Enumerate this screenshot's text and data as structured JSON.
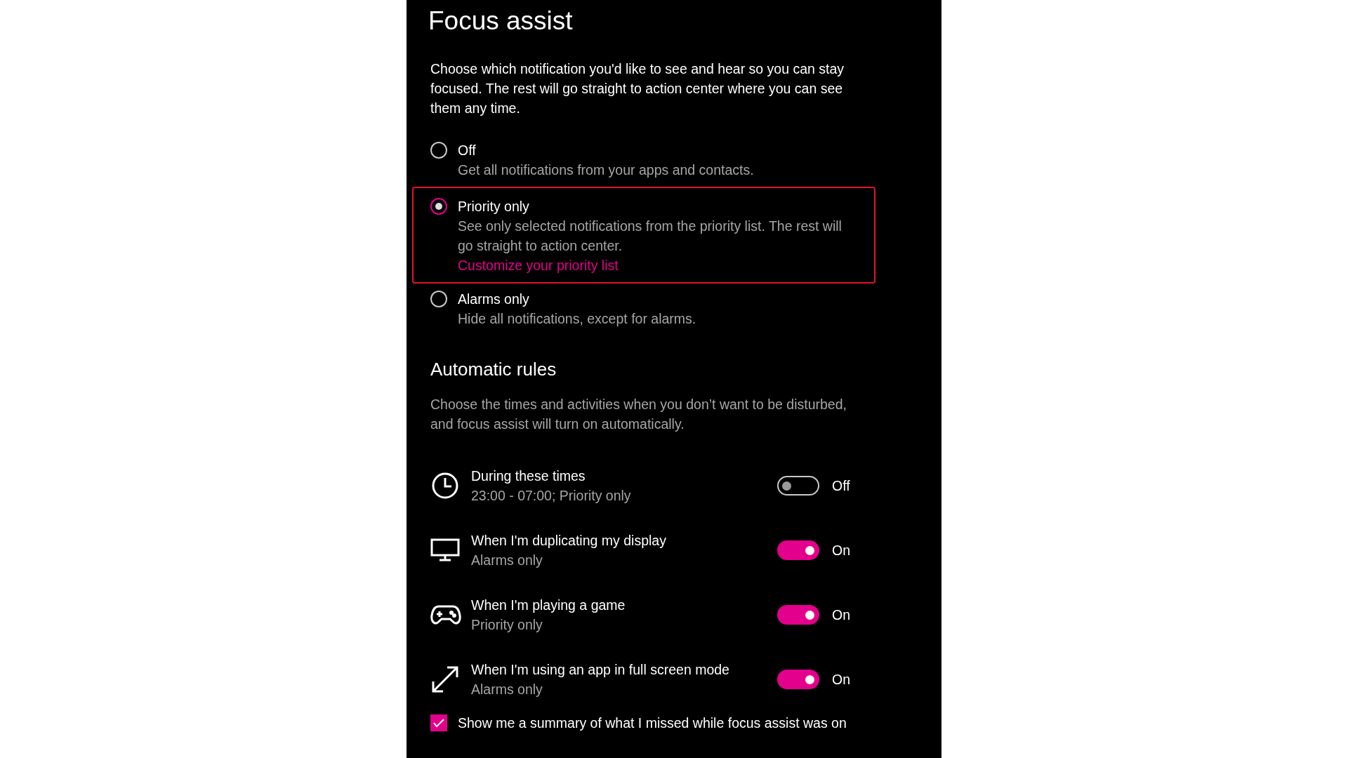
{
  "title": "Focus assist",
  "description": "Choose which notification you'd like to see and hear so you can stay focused. The rest will go straight to action center where you can see them any time.",
  "options": [
    {
      "label": "Off",
      "description": "Get all notifications from your apps and contacts.",
      "selected": false,
      "highlighted": false
    },
    {
      "label": "Priority only",
      "description": "See only selected notifications from the priority list. The rest will go straight to action center.",
      "link": "Customize your priority list",
      "selected": true,
      "highlighted": true
    },
    {
      "label": "Alarms only",
      "description": "Hide all notifications, except for alarms.",
      "selected": false,
      "highlighted": false
    }
  ],
  "automatic_rules": {
    "heading": "Automatic rules",
    "description": "Choose the times and activities when you don’t want to be disturbed, and focus assist will turn on automatically.",
    "rules": [
      {
        "kind": "schedule",
        "title": "During these times",
        "subtitle": "23:00 - 07:00; Priority only",
        "on": false,
        "state_label": "Off"
      },
      {
        "kind": "display",
        "title": "When I'm duplicating my display",
        "subtitle": "Alarms only",
        "on": true,
        "state_label": "On"
      },
      {
        "kind": "game",
        "title": "When I'm playing a game",
        "subtitle": "Priority only",
        "on": true,
        "state_label": "On"
      },
      {
        "kind": "fullscreen",
        "title": "When I'm using an app in full screen mode",
        "subtitle": "Alarms only",
        "on": true,
        "state_label": "On"
      }
    ]
  },
  "summary_checkbox": {
    "label": "Show me a summary of what I missed while focus assist was on",
    "checked": true
  }
}
